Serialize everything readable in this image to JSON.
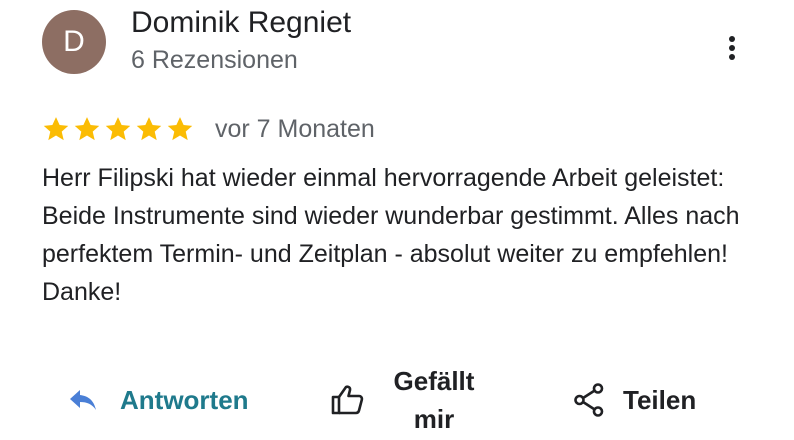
{
  "review": {
    "author": {
      "initial": "D",
      "name": "Dominik Regniet",
      "meta": "6 Rezensionen",
      "avatar_color": "#8d6e63"
    },
    "rating": 5,
    "rating_max": 5,
    "star_color": "#fbbc04",
    "time": "vor 7 Monaten",
    "text": "Herr Filipski hat wieder einmal hervorragende Arbeit geleistet: Beide Instrumente sind wieder wunderbar gestimmt. Alles nach perfektem Termin- und Zeitplan - absolut weiter zu empfehlen! Danke!"
  },
  "menu": {
    "icon": "more-vert-icon"
  },
  "actions": {
    "reply": {
      "label": "Antworten",
      "icon": "reply-icon",
      "color": "#1f7a8c"
    },
    "like": {
      "label": "Gefällt mir",
      "icon": "thumb-up-icon"
    },
    "share": {
      "label": "Teilen",
      "icon": "share-icon"
    }
  }
}
